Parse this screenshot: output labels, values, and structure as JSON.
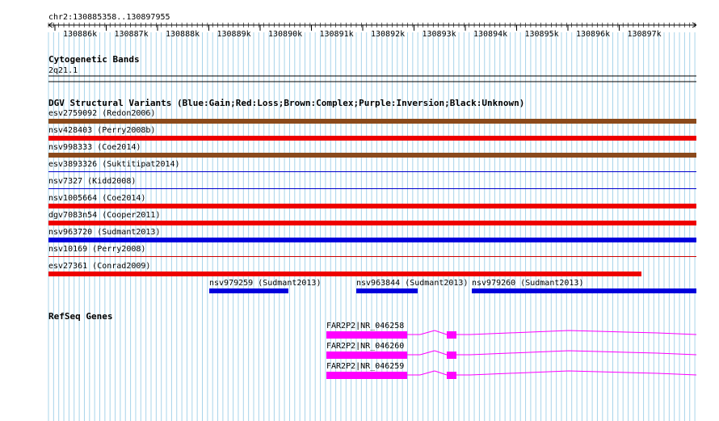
{
  "ruler": {
    "position_label": "chr2:130885358..130897955",
    "ticks": [
      "130886k",
      "130887k",
      "130888k",
      "130889k",
      "130890k",
      "130891k",
      "130892k",
      "130893k",
      "130894k",
      "130895k",
      "130896k",
      "130897k"
    ]
  },
  "cytoband": {
    "title": "Cytogenetic Bands",
    "band": "2q21.1"
  },
  "dgv": {
    "title": "DGV Structural Variants (Blue:Gain;Red:Loss;Brown:Complex;Purple:Inversion;Black:Unknown)",
    "colors": {
      "gain": "#0000dd",
      "loss": "#ee0000",
      "complex": "#8b4a1c",
      "thin_red": "#cc0000",
      "thin_blue": "#0000cc"
    },
    "variants": [
      {
        "label": "esv2759092 (Redon2006)",
        "type": "complex"
      },
      {
        "label": "nsv428403 (Perry2008b)",
        "type": "loss"
      },
      {
        "label": "nsv998333 (Coe2014)",
        "type": "complex"
      },
      {
        "label": "esv3893326 (Suktitipat2014)",
        "type": "gain"
      },
      {
        "label": "nsv7327 (Kidd2008)",
        "type": "gain"
      },
      {
        "label": "nsv1005664 (Coe2014)",
        "type": "loss"
      },
      {
        "label": "dgv7083n54 (Cooper2011)",
        "type": "loss"
      },
      {
        "label": "nsv963720 (Sudmant2013)",
        "type": "gain"
      },
      {
        "label": "nsv10169 (Perry2008)",
        "type": "loss"
      },
      {
        "label": "esv27361 (Conrad2009)",
        "type": "loss"
      }
    ],
    "small_variants": [
      {
        "label": "nsv979259 (Sudmant2013)",
        "type": "gain"
      },
      {
        "label": "nsv963844 (Sudmant2013)",
        "type": "gain"
      },
      {
        "label": "nsv979260 (Sudmant2013)",
        "type": "gain"
      }
    ]
  },
  "refseq": {
    "title": "RefSeq Genes",
    "color": "#ff00ff",
    "genes": [
      {
        "label": "FAR2P2|NR_046258"
      },
      {
        "label": "FAR2P2|NR_046260"
      },
      {
        "label": "FAR2P2|NR_046259"
      }
    ]
  }
}
